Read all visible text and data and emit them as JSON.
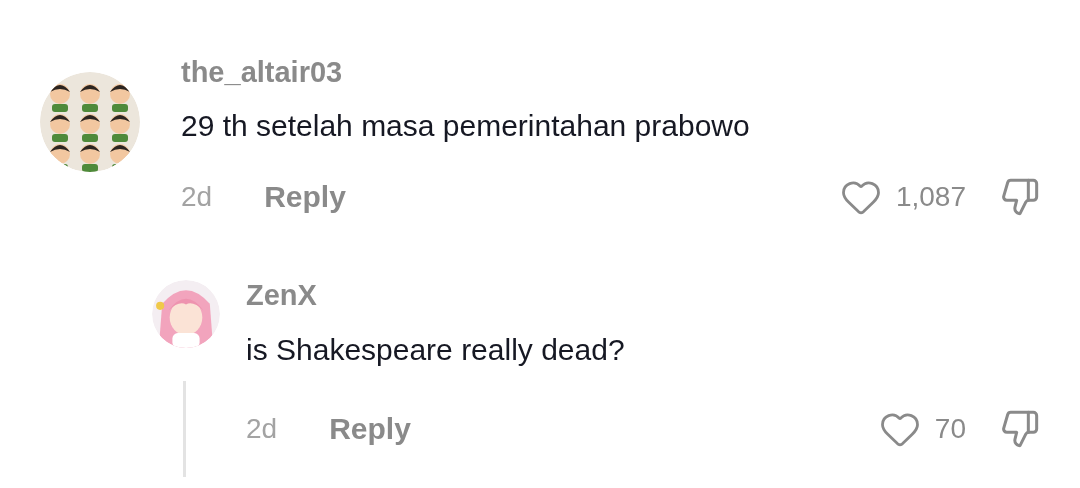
{
  "comments": [
    {
      "username": "the_altair03",
      "text": "29 th setelah masa pemerintahan prabowo",
      "age": "2d",
      "reply_label": "Reply",
      "likes": "1,087",
      "replies": [
        {
          "username": "ZenX",
          "text": "is Shakespeare really dead?",
          "age": "2d",
          "reply_label": "Reply",
          "likes": "70"
        }
      ]
    }
  ]
}
